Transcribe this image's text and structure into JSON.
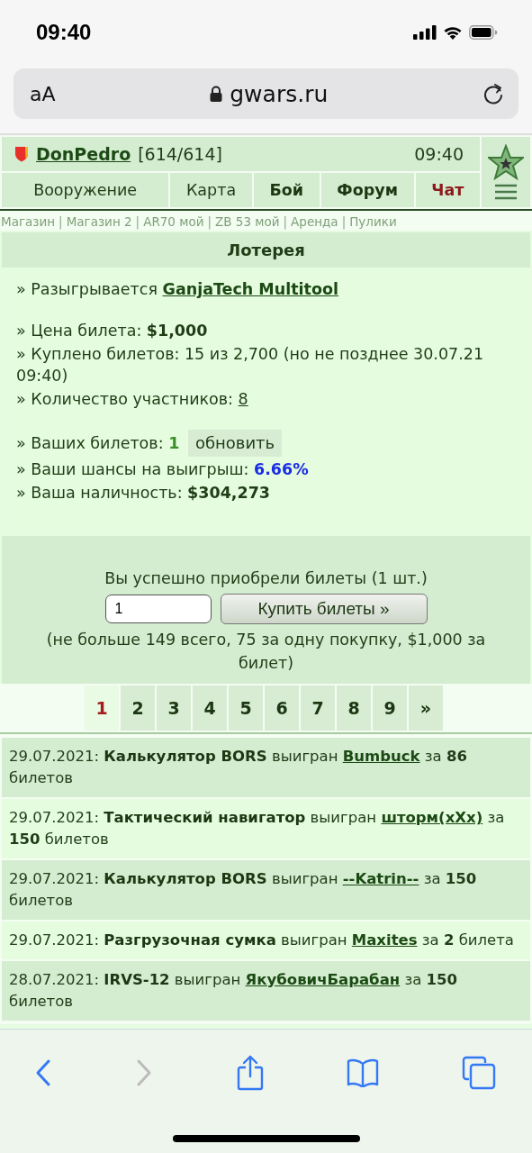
{
  "status_bar": {
    "time": "09:40"
  },
  "browser": {
    "text_size_button": "aA",
    "address": "gwars.ru"
  },
  "header": {
    "user_name": "DonPedro",
    "hp": "[614/614]",
    "time": "09:40"
  },
  "nav": [
    {
      "label": "Вооружение",
      "kind": "plain"
    },
    {
      "label": "Карта",
      "kind": "plain"
    },
    {
      "label": "Бой",
      "kind": "bold"
    },
    {
      "label": "Форум",
      "kind": "bold"
    },
    {
      "label": "Чат",
      "kind": "alert"
    }
  ],
  "sublinks": {
    "separator": "|",
    "links": [
      "Магазин",
      "Магазин 2",
      "AR70 мой",
      "ZB 53 мой",
      "Аренда",
      "Пулики"
    ]
  },
  "lottery": {
    "title": "Лотерея",
    "groups": [
      [
        {
          "kind": "link",
          "prefix": "» Разыгрывается",
          "value": "GanjaTech Multitool"
        }
      ],
      [
        {
          "kind": "text",
          "text": "» Цена билета: **$1,000**"
        },
        {
          "kind": "text",
          "text": "» Куплено билетов: 15 из 2,700 (но не позднее 30.07.21 09:40)"
        },
        {
          "kind": "plain_link",
          "prefix": "» Количество участников:",
          "value": "8"
        }
      ],
      [
        {
          "kind": "count",
          "prefix": "» Ваших билетов:",
          "value": "1",
          "button": "обновить"
        },
        {
          "kind": "chance",
          "prefix": "» Ваши шансы на выигрыш:",
          "value": "6.66%"
        },
        {
          "kind": "text",
          "text": "» Ваша наличность: **$304,273**"
        }
      ]
    ]
  },
  "purchase": {
    "message": "Вы успешно приобрели билеты (1 шт.)",
    "quantity": "1",
    "buy_button": "Купить билеты »",
    "note": "(не больше 149 всего, 75 за одну покупку, $1,000 за билет)"
  },
  "pagination": [
    {
      "label": "1",
      "selected": true
    },
    {
      "label": "2",
      "selected": false
    },
    {
      "label": "3",
      "selected": false
    },
    {
      "label": "4",
      "selected": false
    },
    {
      "label": "5",
      "selected": false
    },
    {
      "label": "6",
      "selected": false
    },
    {
      "label": "7",
      "selected": false
    },
    {
      "label": "8",
      "selected": false
    },
    {
      "label": "9",
      "selected": false
    },
    {
      "label": "»",
      "selected": false
    }
  ],
  "winners": [
    {
      "date": "29.07.2021:",
      "item": "Калькулятор BORS",
      "verb": "выигран",
      "winner": "Bumbuck",
      "tail": "за **86** билетов"
    },
    {
      "date": "29.07.2021:",
      "item": "Тактический навигатор",
      "verb": "выигран",
      "winner": "шторм(xXx)",
      "tail": "за **150** билетов"
    },
    {
      "date": "29.07.2021:",
      "item": "Калькулятор BORS",
      "verb": "выигран",
      "winner": "--Katrin--",
      "tail": "за **150** билетов"
    },
    {
      "date": "29.07.2021:",
      "item": "Разгрузочная сумка",
      "verb": "выигран",
      "winner": "Maxites",
      "tail": "за **2** билета"
    },
    {
      "date": "28.07.2021:",
      "item": "IRVS-12",
      "verb": "выигран",
      "winner": "ЯкубовичБарабан",
      "tail": "за **150** билетов"
    }
  ]
}
